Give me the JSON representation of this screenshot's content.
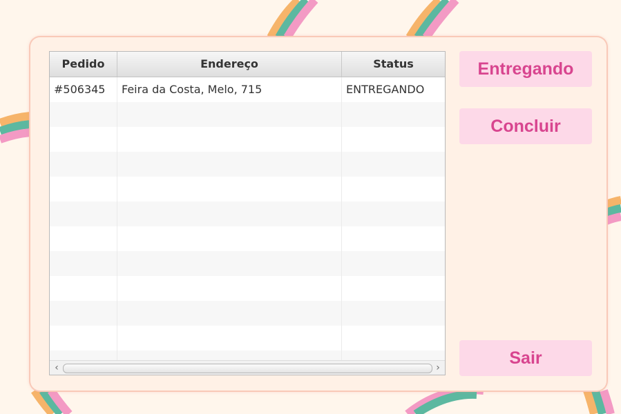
{
  "table": {
    "columns": [
      "Pedido",
      "Endereço",
      "Status"
    ],
    "rows": [
      [
        "#506345",
        "Feira da Costa, Melo, 715",
        "ENTREGANDO"
      ],
      [
        "",
        "",
        ""
      ],
      [
        "",
        "",
        ""
      ],
      [
        "",
        "",
        ""
      ],
      [
        "",
        "",
        ""
      ],
      [
        "",
        "",
        ""
      ],
      [
        "",
        "",
        ""
      ],
      [
        "",
        "",
        ""
      ],
      [
        "",
        "",
        ""
      ],
      [
        "",
        "",
        ""
      ],
      [
        "",
        "",
        ""
      ],
      [
        "",
        "",
        ""
      ]
    ]
  },
  "scrollbar": {
    "left_arrow": "‹",
    "right_arrow": "›"
  },
  "buttons": {
    "entregando": "Entregando",
    "concluir": "Concluir",
    "sair": "Sair"
  },
  "colors": {
    "button_bg": "#fdd9e8",
    "button_text": "#d8458f",
    "rainbow_orange": "#f6b46a",
    "rainbow_green": "#5cb8a0",
    "rainbow_pink": "#f39ac4"
  }
}
